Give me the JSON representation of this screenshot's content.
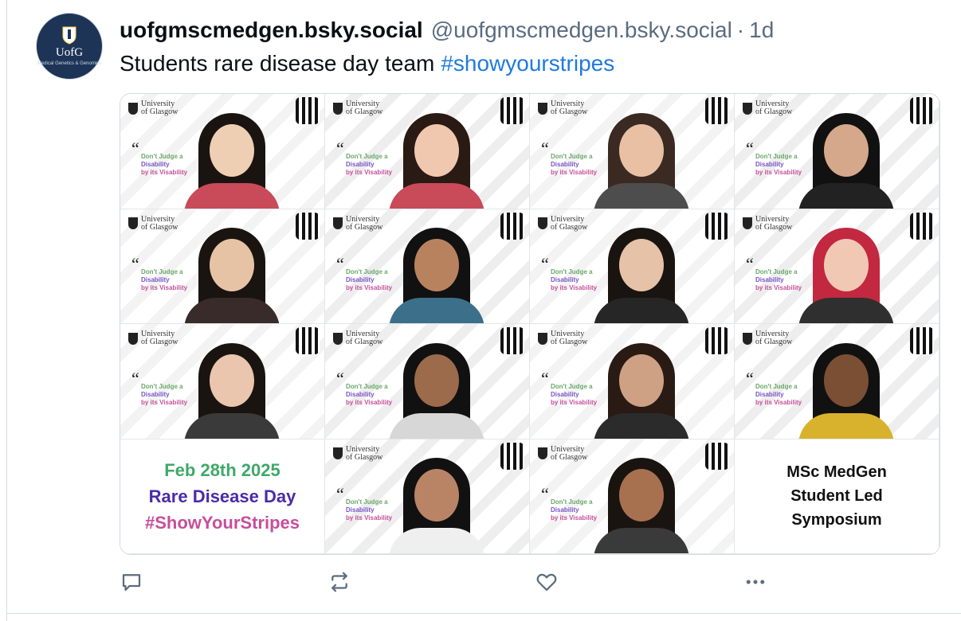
{
  "post": {
    "display_name": "uofgmscmedgen.bsky.social",
    "handle": "@uofgmscmedgen.bsky.social",
    "separator": "·",
    "time_ago": "1d",
    "text": "Students rare disease day team",
    "hashtag": "#showyourstripes"
  },
  "avatar": {
    "monogram": "UofG",
    "subtitle": "Medical Genetics & Genomics"
  },
  "media": {
    "tile_branding": {
      "university_line1": "University",
      "university_line2": "of Glasgow",
      "quote_mark": "“",
      "slogan_line1": "Don't Judge a",
      "slogan_line2": "Disability",
      "slogan_line3": "by its Visability"
    },
    "caption_left": {
      "line1": "Feb 28th 2025",
      "line2": "Rare Disease Day",
      "line3": "#ShowYourStripes"
    },
    "caption_right": {
      "line1": "MSc MedGen",
      "line2": "Student Led",
      "line3": "Symposium"
    }
  },
  "actions": {
    "reply_icon": "speech-bubble",
    "repost_icon": "repost-arrows",
    "like_icon": "heart-outline",
    "more_icon": "ellipsis"
  },
  "colors": {
    "hashtag": "#1f7ae0",
    "muted": "#5a6c80",
    "icon": "#5a6c80",
    "caption_green": "#3fa86a",
    "caption_purple": "#4b2ba8",
    "caption_pink": "#c64f9a"
  }
}
